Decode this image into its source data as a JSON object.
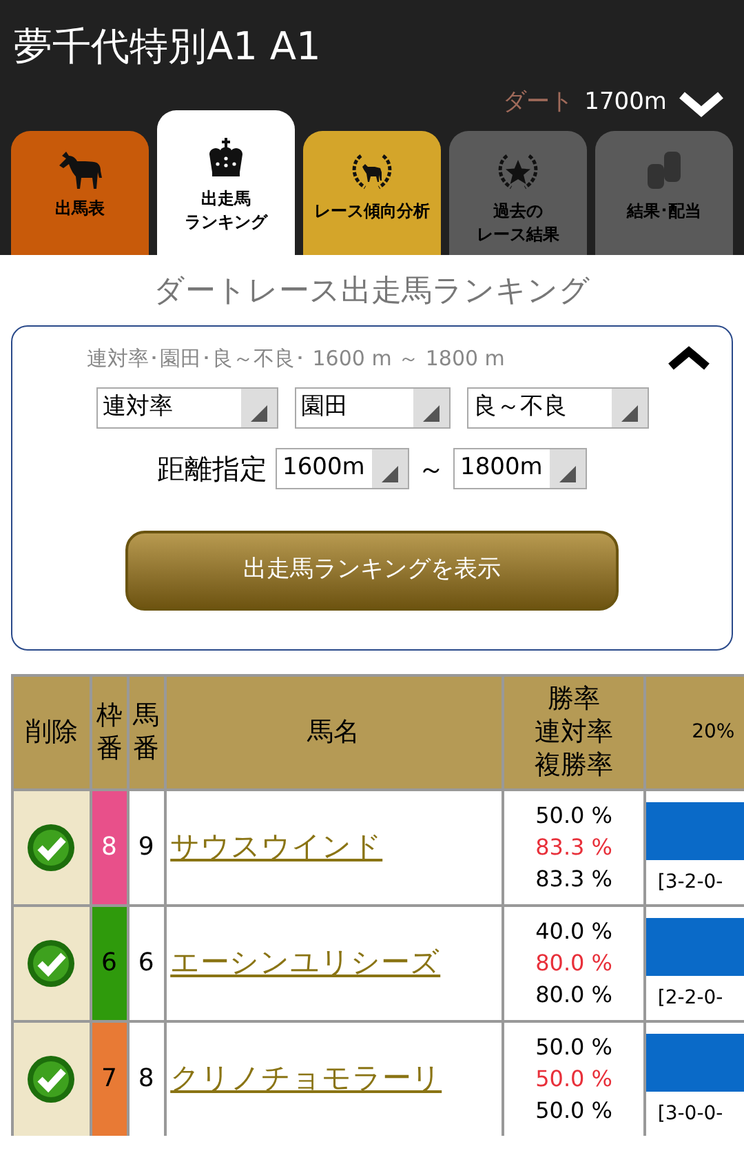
{
  "header": {
    "title": "夢千代特別A1 A1",
    "surface": "ダート",
    "distance": "1700m"
  },
  "tabs": [
    {
      "lines": [
        "出馬表"
      ],
      "kind": "horse",
      "color": "#c85a0a",
      "selected": false
    },
    {
      "lines": [
        "出走馬",
        "ランキング"
      ],
      "kind": "crown",
      "color": "#ffffff",
      "selected": true
    },
    {
      "lines": [
        "レース傾向分析"
      ],
      "kind": "laurel-horse",
      "color": "#d4a52a",
      "selected": false
    },
    {
      "lines": [
        "過去の",
        "レース結果"
      ],
      "kind": "laurel-star",
      "color": "#5a5a5a",
      "selected": false
    },
    {
      "lines": [
        "結果･配当"
      ],
      "kind": "coins",
      "color": "#5a5a5a",
      "selected": false
    }
  ],
  "section_title": "ダートレース出走馬ランキング",
  "filter": {
    "summary": "連対率･園田･良～不良･ 1600 m ～ 1800 m",
    "expanded": true,
    "selects": [
      "連対率",
      "園田",
      "良～不良"
    ],
    "distance_label": "距離指定",
    "distance_from": "1600m",
    "range_sep": "～",
    "distance_to": "1800m",
    "submit": "出走馬ランキングを表示"
  },
  "table": {
    "columns": [
      [
        "削除"
      ],
      [
        "枠",
        "番"
      ],
      [
        "馬",
        "番"
      ],
      [
        "馬名"
      ],
      [
        "勝率",
        "連対率",
        "複勝率"
      ],
      [
        "20%"
      ]
    ],
    "rows": [
      {
        "checked": true,
        "frame": "8",
        "color": "#e8508a",
        "number": "9",
        "name": "サウスウインド",
        "win": "50.0 %",
        "quinella": "83.3 %",
        "show": "83.3 %",
        "record": "[3-2-0-"
      },
      {
        "checked": true,
        "frame": "6",
        "color": "#2f9a0c",
        "number": "6",
        "name": "エーシンユリシーズ",
        "win": "40.0 %",
        "quinella": "80.0 %",
        "show": "80.0 %",
        "record": "[2-2-0-"
      },
      {
        "checked": true,
        "frame": "7",
        "color": "#e87a35",
        "number": "8",
        "name": "クリノチョモラーリ",
        "win": "50.0 %",
        "quinella": "50.0 %",
        "show": "50.0 %",
        "record": "[3-0-0-"
      }
    ]
  }
}
